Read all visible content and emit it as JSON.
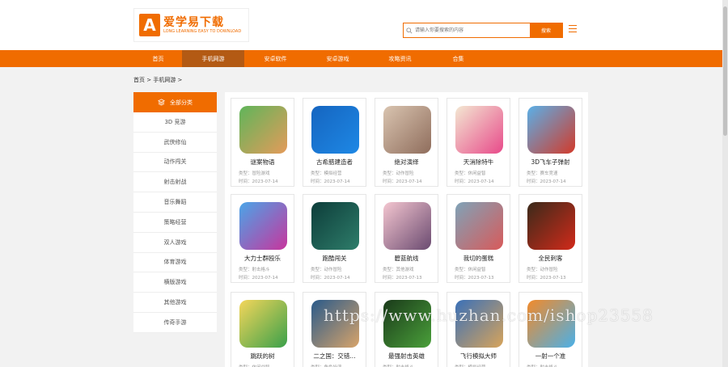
{
  "header": {
    "logo_mark": "A",
    "logo_cn": "爱学易下载",
    "logo_en": "LONG LEARNING EASY TO DOWNLOAD",
    "search_placeholder": "请输入你要搜索的内容",
    "search_button": "搜索"
  },
  "nav": [
    "首页",
    "手机网游",
    "安卓软件",
    "安卓游戏",
    "攻略资讯",
    "合集"
  ],
  "nav_active_index": 1,
  "breadcrumb": "首页 >   手机网游 >",
  "sidebar": {
    "head": "全部分类",
    "items": [
      "3D 竞游",
      "武侠修仙",
      "动作闯关",
      "射击射战",
      "音乐舞蹈",
      "策略经营",
      "双人游戏",
      "体育游戏",
      "横版游戏",
      "其他游戏",
      "传奇手游"
    ]
  },
  "games": [
    {
      "name": "谜案物语",
      "type": "类型：冒险游戏",
      "time": "时间：2023-07-14"
    },
    {
      "name": "古希腊建造者",
      "type": "类型：模拟经营",
      "time": "时间：2023-07-14"
    },
    {
      "name": "绝对演绎",
      "type": "类型：动作冒险",
      "time": "时间：2023-07-14"
    },
    {
      "name": "天消除特牛",
      "type": "类型：休闲益智",
      "time": "时间：2023-07-14"
    },
    {
      "name": "3D飞车子弹射",
      "type": "类型：赛车竞速",
      "time": "时间：2023-07-14"
    },
    {
      "name": "大力士群殴乐",
      "type": "类型：射击格斗",
      "time": "时间：2023-07-14"
    },
    {
      "name": "跑酷闯关",
      "type": "类型：动作冒险",
      "time": "时间：2023-07-14"
    },
    {
      "name": "碧蓝航线",
      "type": "类型：其他游戏",
      "time": "时间：2023-07-13"
    },
    {
      "name": "我切的蛋糕",
      "type": "类型：休闲益智",
      "time": "时间：2023-07-13"
    },
    {
      "name": "全民刺客",
      "type": "类型：动作冒险",
      "time": "时间：2023-07-13"
    },
    {
      "name": "跳跃的树",
      "type": "类型：休闲益智",
      "time": "时间：2023-07-13"
    },
    {
      "name": "二之国：交错...",
      "type": "类型：角色扮演",
      "time": "时间：2023-07-13"
    },
    {
      "name": "最强射击英雄",
      "type": "类型：射击格斗",
      "time": "时间：2023-07-13"
    },
    {
      "name": "飞行模拟大师",
      "type": "类型：模拟经营",
      "time": "时间：2023-07-13"
    },
    {
      "name": "一射一个准",
      "type": "类型：射击格斗",
      "time": "时间：2023-07-13"
    }
  ],
  "watermark": "https://www.huzhan.com/ishop23558",
  "colors": {
    "accent": "#f06c00",
    "nav_active": "#b35a14"
  }
}
